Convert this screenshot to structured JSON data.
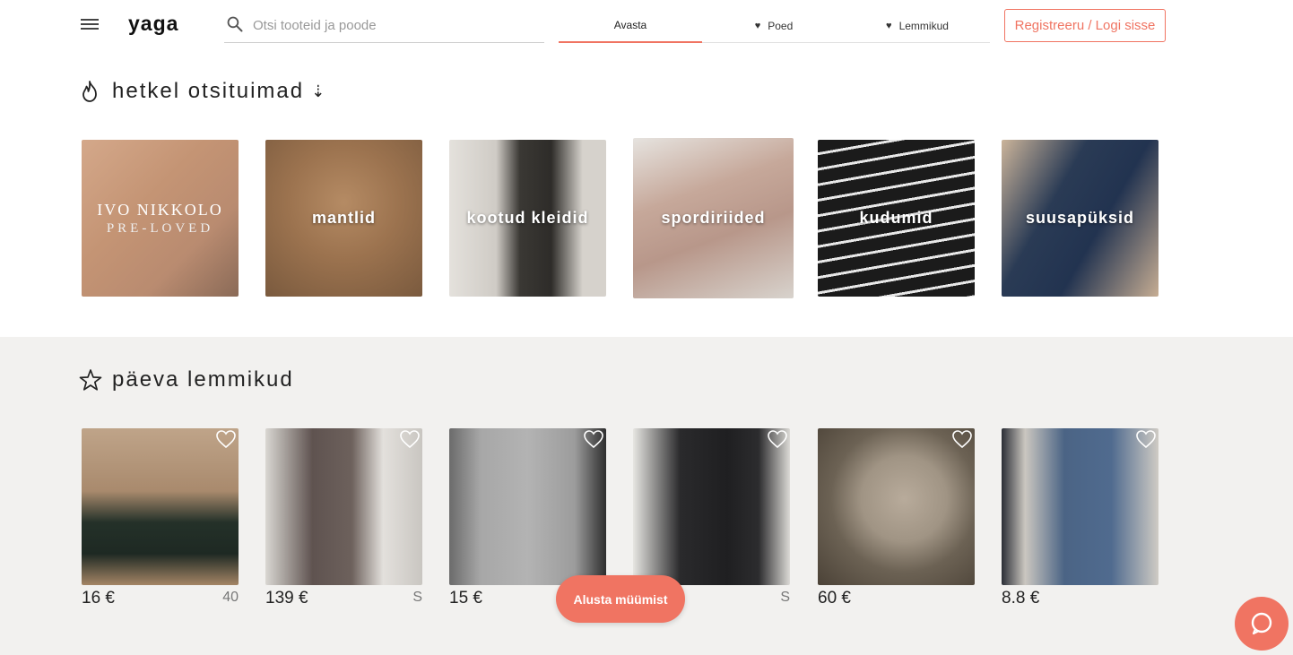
{
  "header": {
    "logo": "yaga",
    "search_placeholder": "Otsi tooteid ja poode",
    "tabs": [
      {
        "label": "Avasta",
        "active": true
      },
      {
        "label": "Poed",
        "icon": "heart-icon"
      },
      {
        "label": "Lemmikud",
        "icon": "heart-icon"
      }
    ],
    "login_label": "Registreeru / Logi sisse"
  },
  "trending": {
    "title": "hetkel otsituimad",
    "icon": "flame-icon",
    "categories": [
      {
        "brand_line1": "IVO NIKKOLO",
        "brand_line2": "PRE-LOVED"
      },
      {
        "label": "mantlid"
      },
      {
        "label": "kootud kleidid"
      },
      {
        "label": "spordiriided"
      },
      {
        "label": "kudumid"
      },
      {
        "label": "suusapüksid"
      }
    ]
  },
  "favorites": {
    "title": "päeva lemmikud",
    "icon": "star-icon",
    "products": [
      {
        "price": "16 €",
        "size": "40"
      },
      {
        "price": "139 €",
        "size": "S"
      },
      {
        "price": "15 €",
        "size": ""
      },
      {
        "price": "",
        "size": "S"
      },
      {
        "price": "60 €",
        "size": ""
      },
      {
        "price": "8.8 €",
        "size": ""
      }
    ]
  },
  "sell_button": "Alusta müümist",
  "colors": {
    "accent": "#f07462",
    "section_bg": "#f2f1ef"
  }
}
